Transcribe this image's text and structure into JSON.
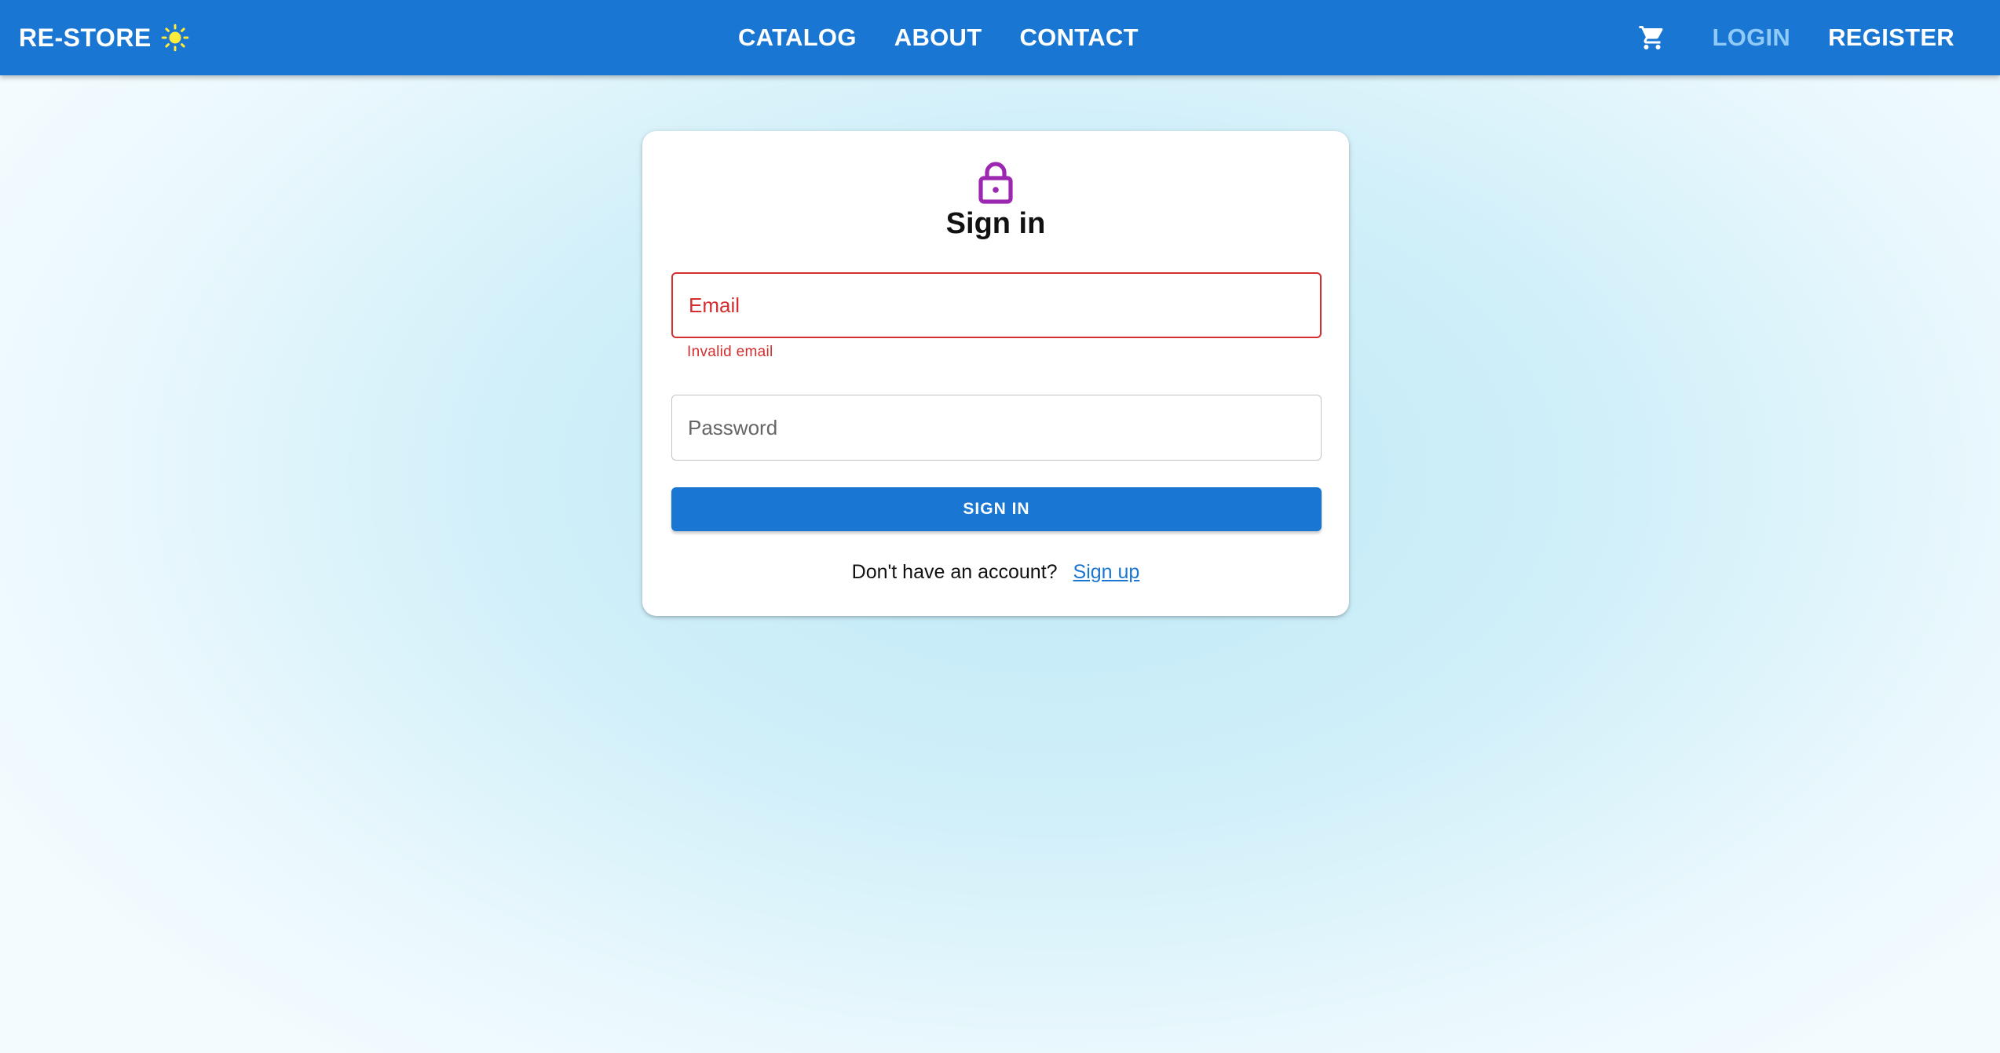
{
  "colors": {
    "primary": "#1976d2",
    "error": "#d32f2f",
    "lock_icon": "#9c27b0",
    "sun_icon": "#ffeb3b",
    "active_link": "#90caf9"
  },
  "header": {
    "brand": "RE-STORE",
    "theme_toggle_icon": "sun-icon",
    "nav_links": [
      {
        "label": "CATALOG"
      },
      {
        "label": "ABOUT"
      },
      {
        "label": "CONTACT"
      }
    ],
    "cart_icon": "shopping-cart-icon",
    "auth_links": [
      {
        "label": "LOGIN",
        "active": true
      },
      {
        "label": "REGISTER",
        "active": false
      }
    ]
  },
  "login_form": {
    "icon": "lock-icon",
    "title": "Sign in",
    "email": {
      "placeholder": "Email",
      "value": "",
      "error_text": "Invalid email"
    },
    "password": {
      "placeholder": "Password",
      "value": ""
    },
    "submit_label": "SIGN IN",
    "footer_text": "Don't have an account?",
    "signup_link": "Sign up"
  }
}
